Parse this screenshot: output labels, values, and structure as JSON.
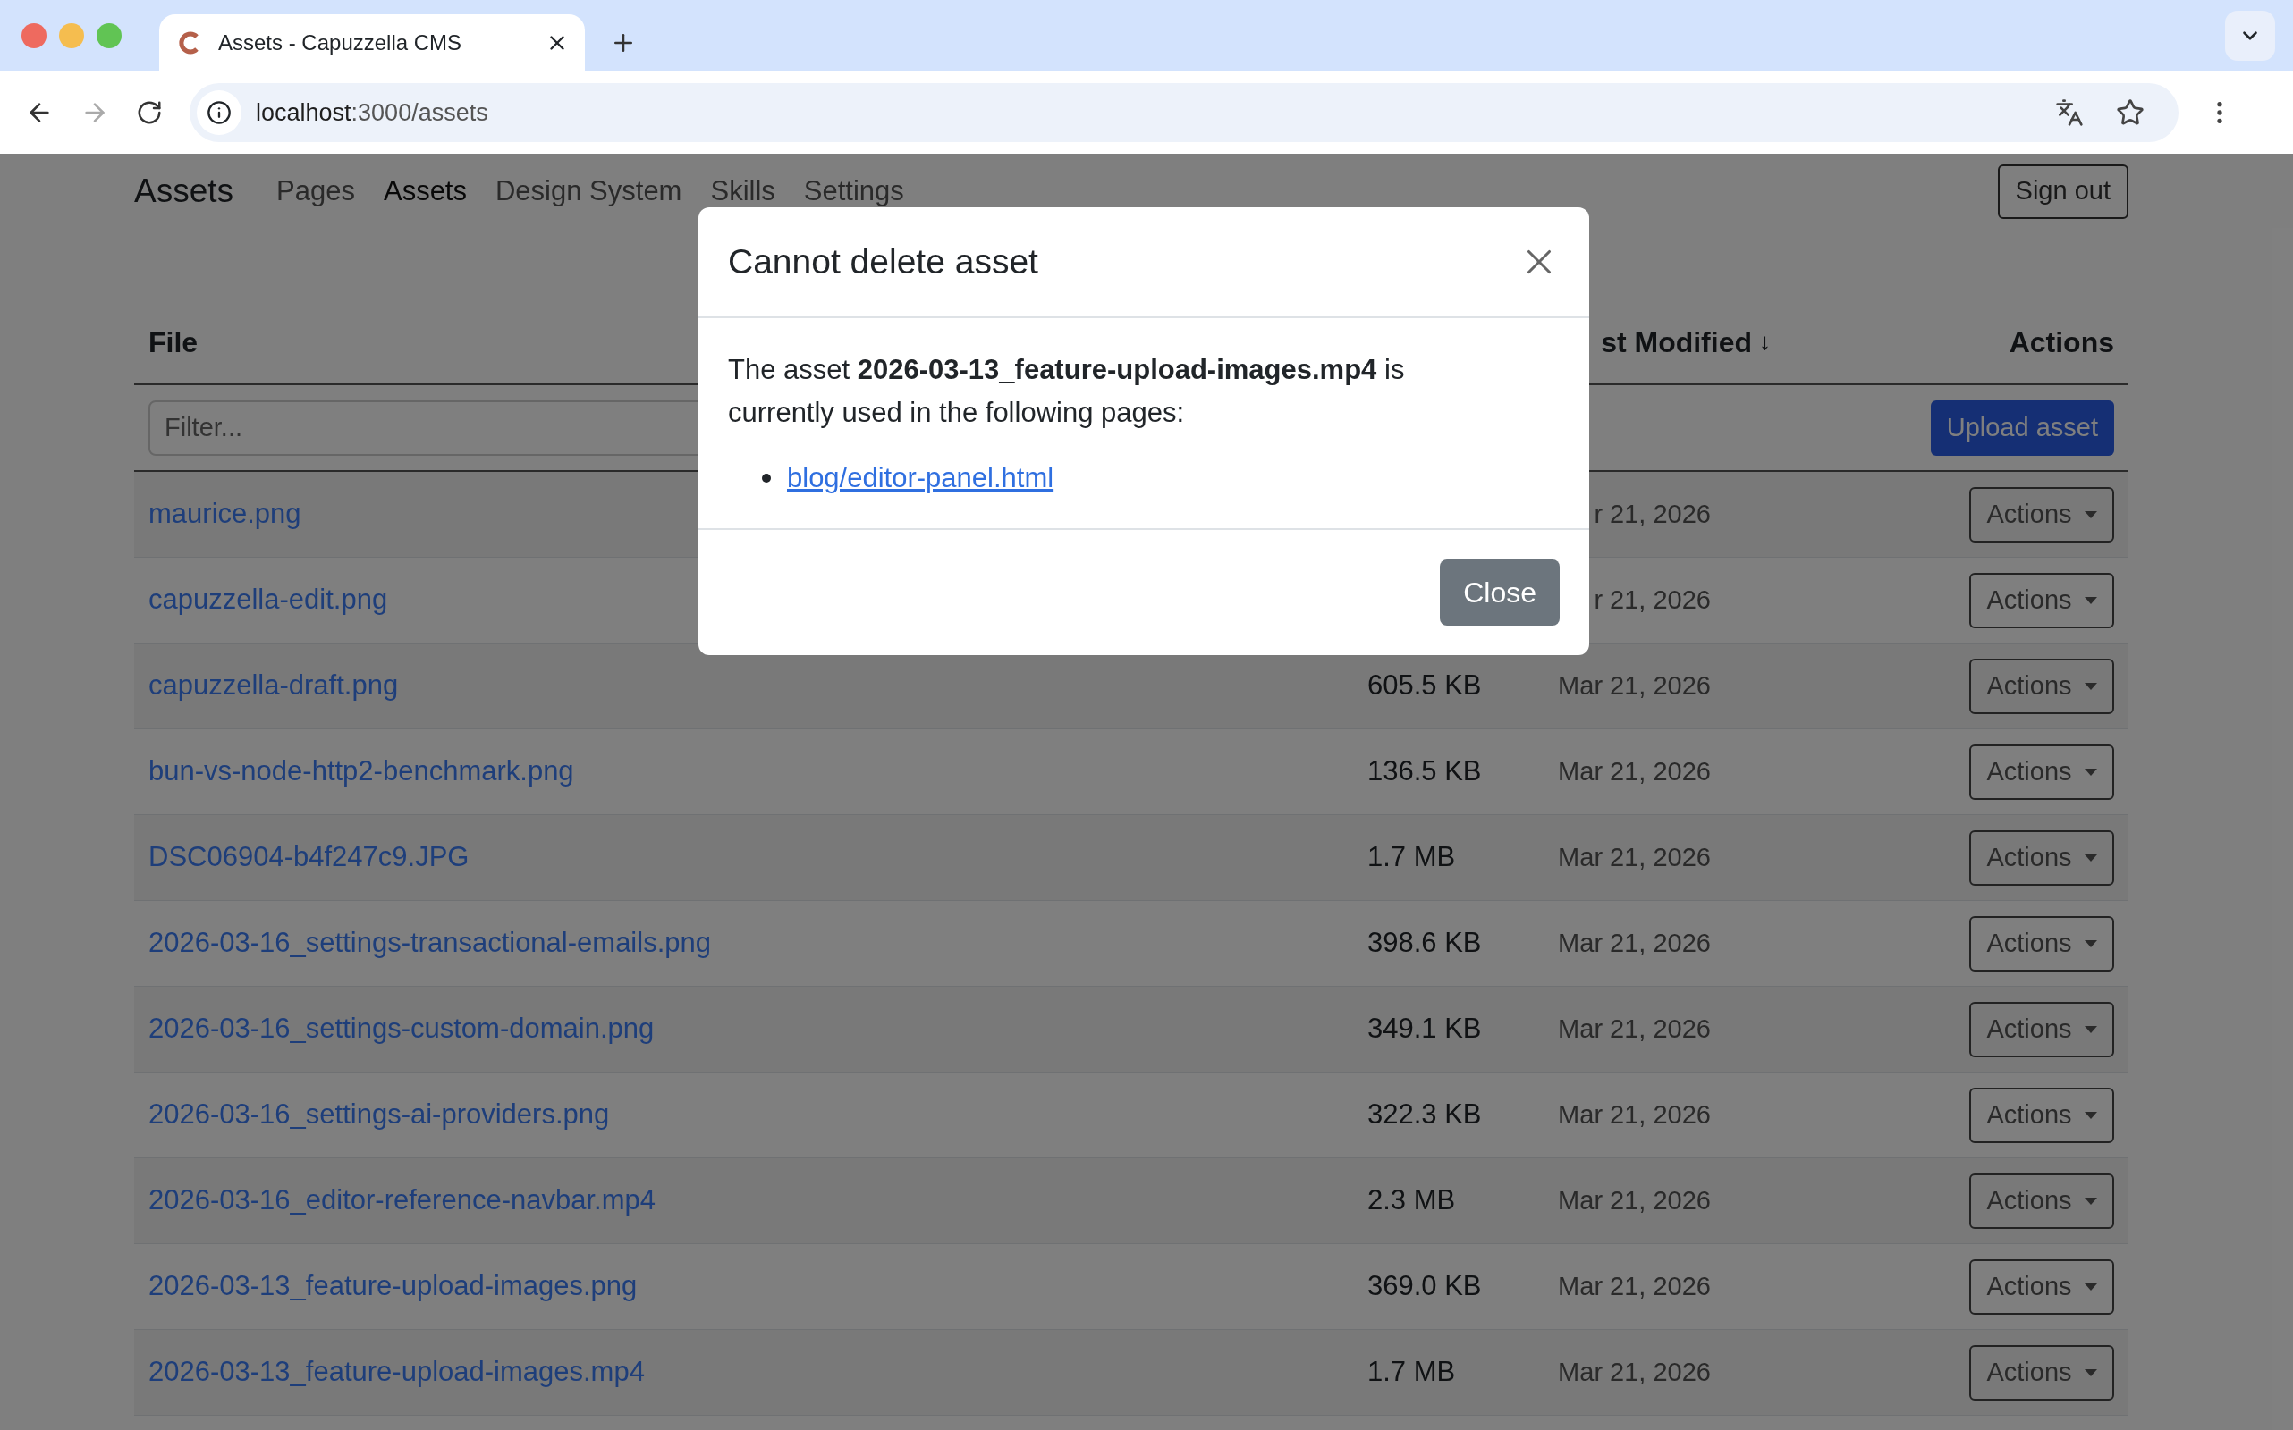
{
  "browser": {
    "tab_title": "Assets - Capuzzella CMS",
    "url_host": "localhost",
    "url_path": ":3000/assets"
  },
  "navbar": {
    "brand": "Assets",
    "links": [
      {
        "label": "Pages",
        "selected": false
      },
      {
        "label": "Assets",
        "selected": true
      },
      {
        "label": "Design System",
        "selected": false
      },
      {
        "label": "Skills",
        "selected": false
      },
      {
        "label": "Settings",
        "selected": false
      }
    ],
    "sign_out": "Sign out"
  },
  "table": {
    "columns": {
      "file": "File",
      "modified": "st Modified",
      "sort_arrow": "↓",
      "actions": "Actions"
    },
    "filter": {
      "placeholder": "Filter..."
    },
    "upload_button": "Upload asset",
    "rows": [
      {
        "file": "maurice.png",
        "modified": "r 21, 2026",
        "action": "Actions"
      },
      {
        "file": "capuzzella-edit.png",
        "modified": "r 21, 2026",
        "action": "Actions"
      },
      {
        "file": "capuzzella-draft.png",
        "size": "605.5 KB",
        "modified": "Mar 21, 2026",
        "action": "Actions"
      },
      {
        "file": "bun-vs-node-http2-benchmark.png",
        "size": "136.5 KB",
        "modified": "Mar 21, 2026",
        "action": "Actions"
      },
      {
        "file": "DSC06904-b4f247c9.JPG",
        "size": "1.7 MB",
        "modified": "Mar 21, 2026",
        "action": "Actions"
      },
      {
        "file": "2026-03-16_settings-transactional-emails.png",
        "size": "398.6 KB",
        "modified": "Mar 21, 2026",
        "action": "Actions"
      },
      {
        "file": "2026-03-16_settings-custom-domain.png",
        "size": "349.1 KB",
        "modified": "Mar 21, 2026",
        "action": "Actions"
      },
      {
        "file": "2026-03-16_settings-ai-providers.png",
        "size": "322.3 KB",
        "modified": "Mar 21, 2026",
        "action": "Actions"
      },
      {
        "file": "2026-03-16_editor-reference-navbar.mp4",
        "size": "2.3 MB",
        "modified": "Mar 21, 2026",
        "action": "Actions"
      },
      {
        "file": "2026-03-13_feature-upload-images.png",
        "size": "369.0 KB",
        "modified": "Mar 21, 2026",
        "action": "Actions"
      },
      {
        "file": "2026-03-13_feature-upload-images.mp4",
        "size": "1.7 MB",
        "modified": "Mar 21, 2026",
        "action": "Actions"
      }
    ]
  },
  "dialog": {
    "title": "Cannot delete asset",
    "message": "The asset **2026-03-13_feature-upload-images.mp4** is currently used in the following pages:",
    "pages": [
      "blog/editor-panel.html"
    ],
    "close_button": "Close"
  }
}
